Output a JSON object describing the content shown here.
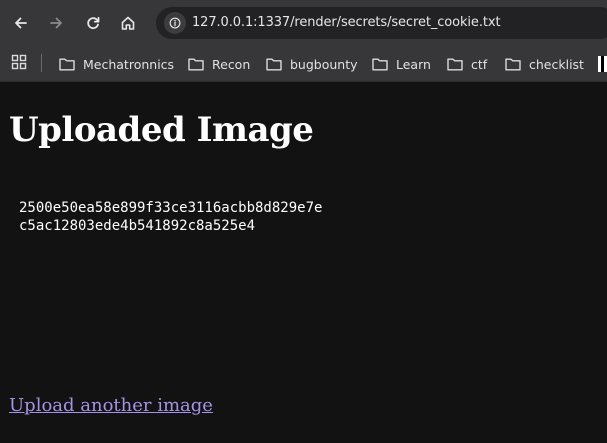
{
  "browser": {
    "url": "127.0.0.1:1337/render/secrets/secret_cookie.txt",
    "bookmarks": [
      {
        "label": "Mechatronnics"
      },
      {
        "label": "Recon"
      },
      {
        "label": "bugbounty"
      },
      {
        "label": "Learn"
      },
      {
        "label": "ctf"
      },
      {
        "label": "checklist"
      }
    ]
  },
  "page": {
    "title": "Uploaded Image",
    "secret_lines": [
      "2500e50ea58e899f33ce3116acbb8d829e7e",
      "c5ac12803ede4b541892c8a525e4"
    ],
    "upload_link": "Upload another image"
  },
  "colors": {
    "background": "#121212",
    "link": "#a493e6",
    "chrome": "#37373a"
  }
}
